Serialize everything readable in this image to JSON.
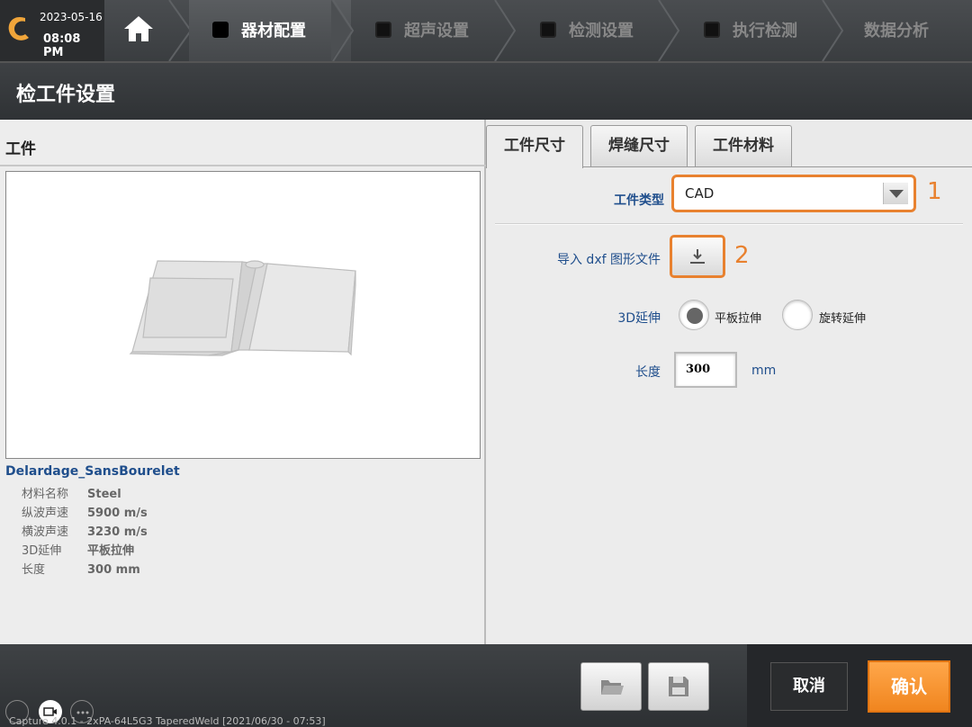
{
  "header": {
    "date": "2023-05-16",
    "time": "08:08 PM",
    "steps": [
      {
        "label": "器材配置",
        "active": true
      },
      {
        "label": "超声设置",
        "active": false
      },
      {
        "label": "检测设置",
        "active": false
      },
      {
        "label": "执行检测",
        "active": false
      },
      {
        "label": "数据分析",
        "active": false
      }
    ]
  },
  "page_title": "检工件设置",
  "left_panel": {
    "title": "工件",
    "part_name": "Delardage_SansBourelet",
    "properties": [
      {
        "key": "材料名称",
        "value": "Steel"
      },
      {
        "key": "纵波声速",
        "value": "5900 m/s"
      },
      {
        "key": "横波声速",
        "value": "3230 m/s"
      },
      {
        "key": "3D延伸",
        "value": "平板拉伸"
      },
      {
        "key": "长度",
        "value": "300 mm"
      }
    ]
  },
  "right_panel": {
    "tabs": [
      {
        "label": "工件尺寸",
        "active": true
      },
      {
        "label": "焊缝尺寸",
        "active": false
      },
      {
        "label": "工件材料",
        "active": false
      }
    ],
    "part_type_label": "工件类型",
    "part_type_value": "CAD",
    "annotation_1": "1",
    "import_label": "导入 dxf 图形文件",
    "annotation_2": "2",
    "extension_label": "3D延伸",
    "extension_options": [
      {
        "label": "平板拉伸",
        "selected": true
      },
      {
        "label": "旋转延伸",
        "selected": false
      }
    ],
    "length_label": "长度",
    "length_value": "300",
    "length_unit": "mm"
  },
  "footer": {
    "cancel_label": "取消",
    "confirm_label": "确认",
    "status_text": "Capture 4.0.1 - 2xPA-64L5G3  TaperedWeld [2021/06/30 - 07:53]"
  },
  "colors": {
    "accent": "#e8812f",
    "label_blue": "#1f4e8c"
  },
  "icons": [
    "home-icon",
    "logo-icon",
    "dropdown-arrow-icon",
    "download-icon",
    "folder-icon",
    "save-icon"
  ]
}
